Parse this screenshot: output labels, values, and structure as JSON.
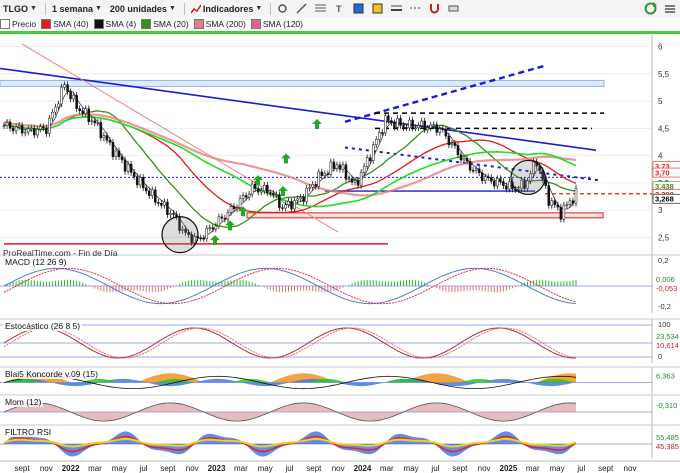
{
  "toolbar": {
    "symbol": "TLGO",
    "period": "1 semana",
    "units": "200 unidades",
    "indicators": "Indicadores"
  },
  "legend": [
    {
      "label": "Precio",
      "color": "#ffffff"
    },
    {
      "label": "SMA (40)",
      "color": "#e21c1c"
    },
    {
      "label": "SMA (4)",
      "color": "#111111"
    },
    {
      "label": "SMA (20)",
      "color": "#3c8c1e"
    },
    {
      "label": "SMA (200)",
      "color": "#e87d7d"
    },
    {
      "label": "SMA (120)",
      "color": "#e85d9a"
    }
  ],
  "source_text": "ProRealTime.com - Fin de Día",
  "price_axis": {
    "ticks": [
      "6",
      "5,5",
      "5",
      "4,5",
      "4",
      "3,5",
      "3",
      "2,5"
    ],
    "value_labels": [
      {
        "text": "3,73",
        "color": "#e21c1c"
      },
      {
        "text": "3,70",
        "color": "#e21c1c"
      },
      {
        "text": "3,438",
        "color": "#3c8c1e"
      },
      {
        "text": "3,290",
        "color": "#e21c1c"
      },
      {
        "text": "3,268",
        "color": "#000000"
      }
    ]
  },
  "panels": [
    {
      "title": "MACD (12 26 9)",
      "axis": [
        "0,2",
        "-0,2"
      ],
      "values": [
        "0,006",
        "-0,053"
      ]
    },
    {
      "title": "Estocástico (26 8 5)",
      "axis": [
        "100",
        "0"
      ],
      "values": [
        "23,534",
        "10,614"
      ]
    },
    {
      "title": "Blai5 Koncorde v.09 (15)",
      "axis": [],
      "values": [
        "6,363"
      ]
    },
    {
      "title": "Mom (12)",
      "axis": [],
      "values": [
        "-0,310"
      ]
    },
    {
      "title": "FILTRO RSI",
      "axis": [],
      "values": [
        "55,485",
        "45,385"
      ]
    }
  ],
  "x_axis": [
    {
      "label": "sept",
      "bold": false
    },
    {
      "label": "nov",
      "bold": false
    },
    {
      "label": "2022",
      "bold": true
    },
    {
      "label": "mar",
      "bold": false
    },
    {
      "label": "may",
      "bold": false
    },
    {
      "label": "jul",
      "bold": false
    },
    {
      "label": "sept",
      "bold": false
    },
    {
      "label": "nov",
      "bold": false
    },
    {
      "label": "2023",
      "bold": true
    },
    {
      "label": "mar",
      "bold": false
    },
    {
      "label": "may",
      "bold": false
    },
    {
      "label": "jul",
      "bold": false
    },
    {
      "label": "sept",
      "bold": false
    },
    {
      "label": "nov",
      "bold": false
    },
    {
      "label": "2024",
      "bold": true
    },
    {
      "label": "mar",
      "bold": false
    },
    {
      "label": "may",
      "bold": false
    },
    {
      "label": "jul",
      "bold": false
    },
    {
      "label": "sept",
      "bold": false
    },
    {
      "label": "nov",
      "bold": false
    },
    {
      "label": "2025",
      "bold": true
    },
    {
      "label": "mar",
      "bold": false
    },
    {
      "label": "may",
      "bold": false
    },
    {
      "label": "jul",
      "bold": false
    },
    {
      "label": "sept",
      "bold": false
    },
    {
      "label": "nov",
      "bold": false
    }
  ],
  "colors": {
    "price": "#1a1a1a",
    "trend_blue": "#1c1ccc",
    "sma40": "#e21c1c",
    "sma20": "#3c8c1e",
    "sma200": "#e87d7d",
    "sma120": "#e85d9a",
    "bright_green": "#22dd22",
    "arrow_green": "#22aa22"
  }
}
